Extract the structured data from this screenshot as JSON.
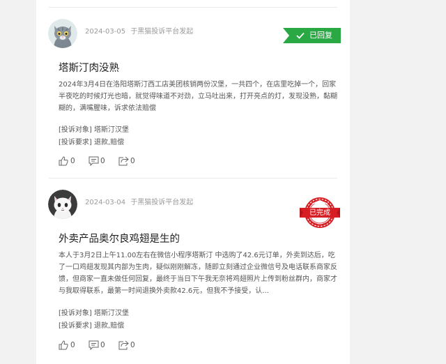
{
  "posts": [
    {
      "date": "2024-03-05",
      "source": "于黑猫投诉平台发起",
      "status": "已回复",
      "status_color": "#2aa844",
      "avatar_icon": "gray-cat-avatar",
      "title": "塔斯汀肉没熟",
      "body_lines": [
        "2024年3月4日在洛阳塔斯汀西工店美团核销两份汉堡，一共四个，在店里吃掉一个，回家",
        "半夜吃的时候灯光也暗，就觉得味道不对劲，立马吐出来，打开亮点的灯，发现没熟，黏糊",
        "糊的，满嘴腥味，诉求依法赔偿"
      ],
      "target_label": "[投诉对象]",
      "target": "塔斯汀汉堡",
      "request_label": "[投诉要求]",
      "request": "退款,赔偿",
      "likes": "0",
      "comments": "0",
      "shares": "0"
    },
    {
      "date": "2024-03-04",
      "source": "于黑猫投诉平台发起",
      "status": "已完成",
      "status_color": "#d81e25",
      "avatar_icon": "white-cat-avatar",
      "title": "外卖产品奥尔良鸡翅是生的",
      "body_lines": [
        "本人于3月2日上午11.00左右在微信小程序塔斯汀 中选购了42.6元订单，外卖到达后，吃",
        "了一口鸡翅发现其内部为生肉，疑似刚刚解冻，随即立刻通过企业微信号及电话联系商家反",
        "馈，但商家一直未做任何回复，最终于当日下午我无奈将鸡翅照片上传到粉丝群内，商家才",
        "与我取得联系，最第一时间退换外卖款42.6元，但我不予接受，认..."
      ],
      "target_label": "[投诉对象]",
      "target": "塔斯汀汉堡",
      "request_label": "[投诉要求]",
      "request": "退款,赔偿",
      "likes": "0",
      "comments": "0",
      "shares": "0"
    }
  ]
}
